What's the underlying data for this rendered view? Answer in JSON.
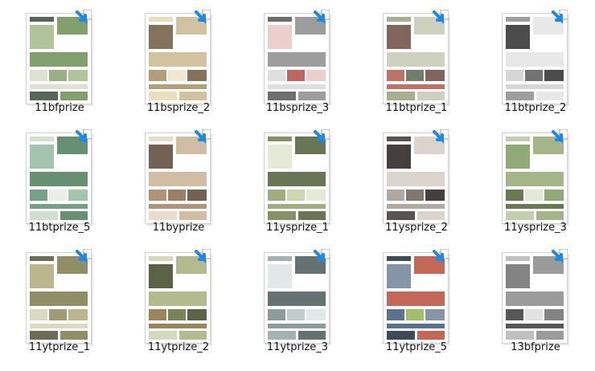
{
  "files": [
    {
      "name": "11bfprize",
      "theme": "green"
    },
    {
      "name": "11bsprize_2",
      "theme": "beige"
    },
    {
      "name": "11bsprize_3",
      "theme": "redgray"
    },
    {
      "name": "11btprize_1",
      "theme": "mixed"
    },
    {
      "name": "11btprize_2",
      "theme": "dark"
    },
    {
      "name": "11btprize_5",
      "theme": "green2"
    },
    {
      "name": "11byprize",
      "theme": "brown"
    },
    {
      "name": "11ysprize_1",
      "theme": "green3"
    },
    {
      "name": "11ysprize_2",
      "theme": "dark2"
    },
    {
      "name": "11ysprize_3",
      "theme": "green4"
    },
    {
      "name": "11ytprize_1",
      "theme": "olive"
    },
    {
      "name": "11ytprize_2",
      "theme": "olive2"
    },
    {
      "name": "11ytprize_3",
      "theme": "gray"
    },
    {
      "name": "11ytprize_5",
      "theme": "navy"
    },
    {
      "name": "13bfprize",
      "theme": "gray2"
    }
  ],
  "colors": {
    "accent": "#1e88e5",
    "label": "#111111"
  }
}
